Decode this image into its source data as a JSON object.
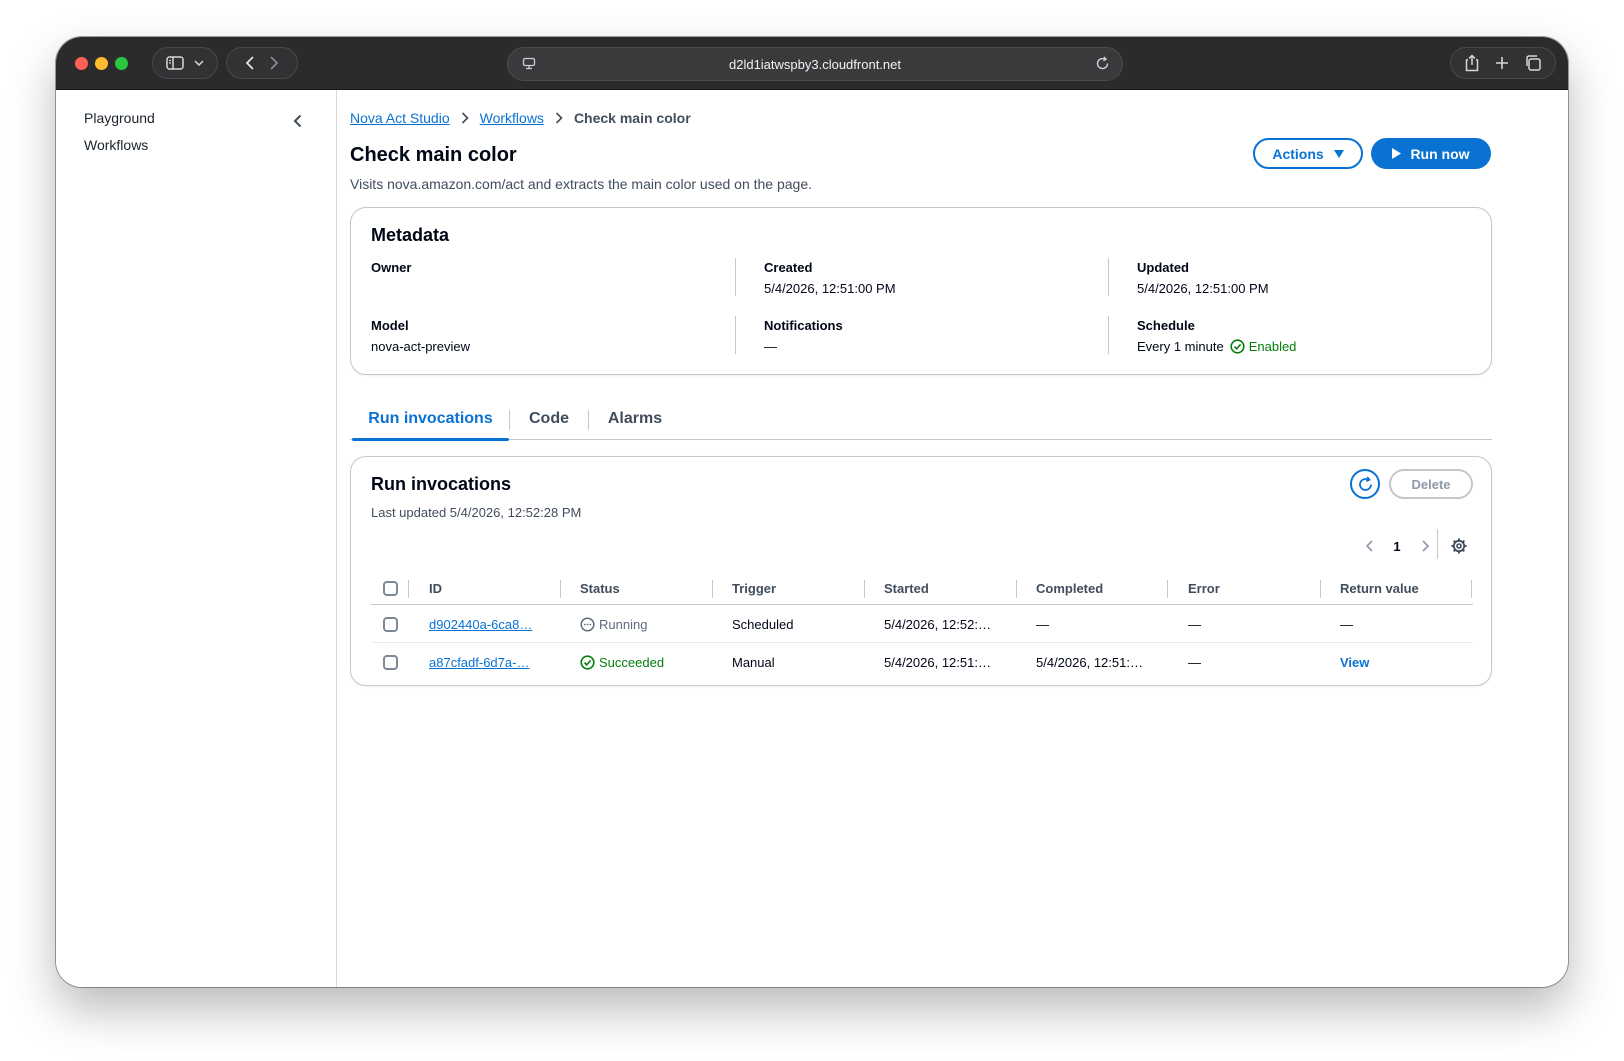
{
  "browser": {
    "address": "d2ld1iatwspby3.cloudfront.net"
  },
  "sidebar": {
    "items": [
      {
        "label": "Playground"
      },
      {
        "label": "Workflows"
      }
    ]
  },
  "breadcrumb": {
    "items": [
      {
        "label": "Nova Act Studio"
      },
      {
        "label": "Workflows"
      }
    ],
    "current": "Check main color"
  },
  "header": {
    "title": "Check main color",
    "description": "Visits nova.amazon.com/act and extracts the main color used on the page.",
    "actions_label": "Actions",
    "run_now_label": "Run now"
  },
  "metadata": {
    "title": "Metadata",
    "owner_label": "Owner",
    "owner_value": "",
    "created_label": "Created",
    "created_value": "5/4/2026, 12:51:00 PM",
    "updated_label": "Updated",
    "updated_value": "5/4/2026, 12:51:00 PM",
    "model_label": "Model",
    "model_value": "nova-act-preview",
    "notifications_label": "Notifications",
    "notifications_value": "—",
    "schedule_label": "Schedule",
    "schedule_value": "Every 1 minute",
    "schedule_status": "Enabled"
  },
  "tabs": [
    {
      "label": "Run invocations",
      "active": true
    },
    {
      "label": "Code",
      "active": false
    },
    {
      "label": "Alarms",
      "active": false
    }
  ],
  "runs": {
    "title": "Run invocations",
    "last_updated": "Last updated 5/4/2026, 12:52:28 PM",
    "delete_label": "Delete",
    "page": "1",
    "columns": [
      "ID",
      "Status",
      "Trigger",
      "Started",
      "Completed",
      "Error",
      "Return value"
    ],
    "rows": [
      {
        "id": "d902440a-6ca8…",
        "status": "Running",
        "trigger": "Scheduled",
        "started": "5/4/2026, 12:52:…",
        "completed": "—",
        "error": "—",
        "return_value": "—"
      },
      {
        "id": "a87cfadf-6d7a-…",
        "status": "Succeeded",
        "trigger": "Manual",
        "started": "5/4/2026, 12:51:…",
        "completed": "5/4/2026, 12:51:…",
        "error": "—",
        "return_value": "View"
      }
    ]
  },
  "colors": {
    "accent": "#0972d3",
    "success": "#037f0c",
    "titlebar": "#2b2b2d"
  }
}
